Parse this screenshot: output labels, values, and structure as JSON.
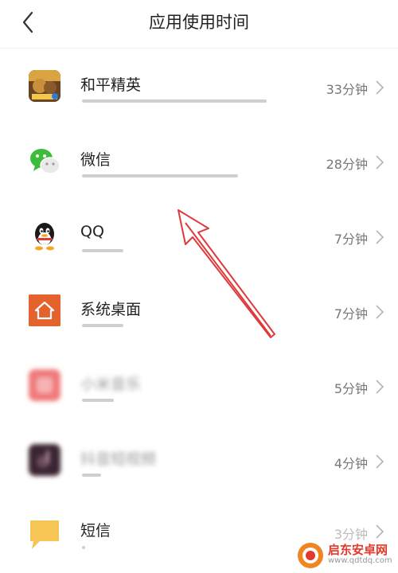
{
  "header": {
    "title": "应用使用时间"
  },
  "apps": [
    {
      "name": "和平精英",
      "duration": "33分钟",
      "usage_fraction": 0.58,
      "icon": "peace-elite-icon"
    },
    {
      "name": "微信",
      "duration": "28分钟",
      "usage_fraction": 0.49,
      "icon": "wechat-icon"
    },
    {
      "name": "QQ",
      "duration": "7分钟",
      "usage_fraction": 0.13,
      "icon": "qq-icon"
    },
    {
      "name": "系统桌面",
      "duration": "7分钟",
      "usage_fraction": 0.13,
      "icon": "home-launcher-icon"
    },
    {
      "name": "小米音乐",
      "duration": "5分钟",
      "usage_fraction": 0.1,
      "icon": "music-app-icon"
    },
    {
      "name": "抖音短视频",
      "duration": "4分钟",
      "usage_fraction": 0.06,
      "icon": "douyin-icon"
    },
    {
      "name": "短信",
      "duration": "3分钟",
      "usage_fraction": 0.01,
      "icon": "sms-icon"
    }
  ],
  "watermark": {
    "title": "启东安卓网",
    "url": "www.qdtdq.com"
  },
  "colors": {
    "bar": "#cfcfcf",
    "arrow": "#e0393b",
    "launcher": "#e4622c",
    "wechat": "#3dbb3a",
    "sms": "#f6c555"
  }
}
